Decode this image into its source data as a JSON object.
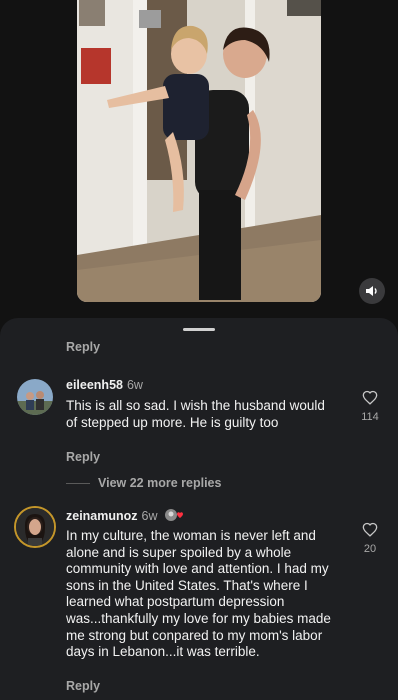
{
  "comments": [
    {
      "username": "eileenh58",
      "time": "6w",
      "text": "This is all so sad. I wish the husband would of stepped up more. He is guilty too",
      "likes": "114",
      "reply_label": "Reply"
    },
    {
      "username": "zeinamunoz",
      "time": "6w",
      "text": "In my culture, the woman is never left and alone and is super spoiled by a whole community with love and attention. I had my sons in the United States. That's where I learned what postpartum depression was...thankfully my love for my babies made me strong but conpared to my mom's labor days in Lebanon...it was terrible.",
      "likes": "20",
      "reply_label": "Reply"
    }
  ],
  "top_reply_label": "Reply",
  "view_more_replies": "View 22 more replies",
  "icons": {
    "sound": "speaker-icon",
    "like": "heart-outline-icon"
  },
  "colors": {
    "background": "#121212",
    "sheet": "#1e1f22",
    "secondary_text": "#a8a8a8"
  }
}
